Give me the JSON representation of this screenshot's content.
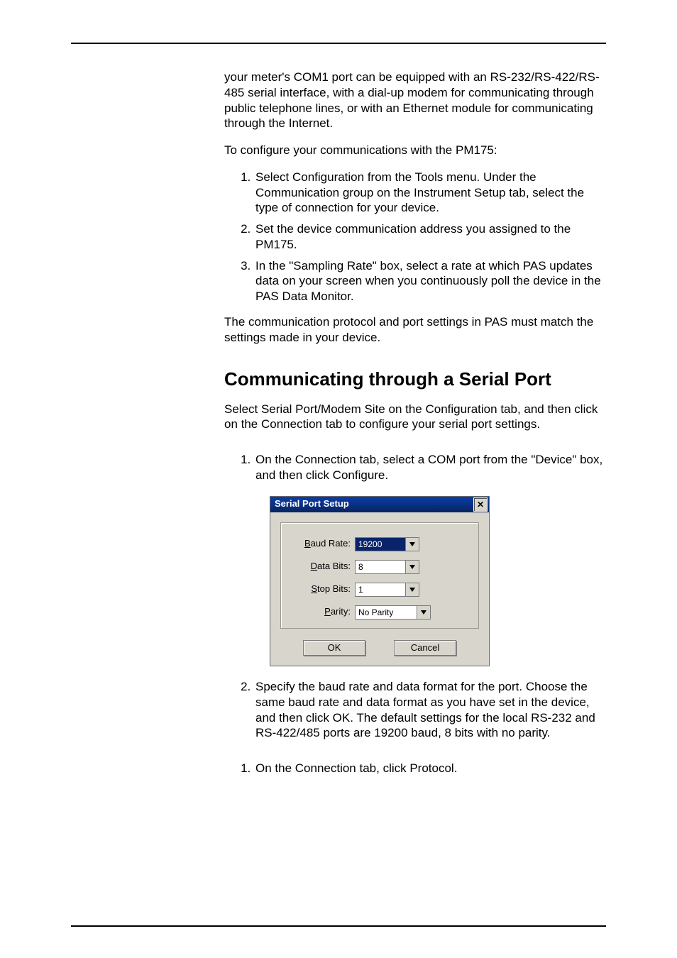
{
  "intro": {
    "p1": "your meter's COM1 port can be equipped with an RS-232/RS-422/RS-485 serial interface, with a dial-up modem for communicating through public telephone lines, or with an Ethernet module for communicating through the Internet.",
    "p2": "To configure your communications with the PM175:",
    "steps": [
      "Select Configuration from the Tools menu. Under the Communication group on the Instrument Setup tab, select the type of connection for your device.",
      "Set the device communication address you assigned to the PM175.",
      "In the \"Sampling Rate\" box, select a rate at which PAS updates data on your screen when you continuously poll the device in the PAS Data Monitor."
    ],
    "p3": "The communication protocol and port settings in PAS must match the settings made in your device."
  },
  "section": {
    "heading": "Communicating through a Serial Port",
    "p1": "Select Serial Port/Modem Site on the Configuration tab, and then click on the Connection tab to configure your serial port settings.",
    "step1": "On the Connection tab, select a COM port from the \"Device\" box, and then click Configure.",
    "step2": "Specify the baud rate and data format for the port. Choose the same baud rate and data format as you have set in the device, and then click OK. The default settings for the local RS-232 and RS-422/485 ports are 19200 baud, 8 bits with no parity.",
    "after_step": "On the Connection tab, click Protocol."
  },
  "dialog": {
    "title": "Serial Port Setup",
    "fields": {
      "baud": {
        "label_pre": "B",
        "label_rest": "aud Rate:",
        "value": "19200"
      },
      "data": {
        "label_pre": "D",
        "label_rest": "ata Bits:",
        "value": "8"
      },
      "stop": {
        "label_pre": "S",
        "label_rest": "top Bits:",
        "value": "1"
      },
      "parity": {
        "label_pre": "P",
        "label_rest": "arity:",
        "value": "No Parity"
      }
    },
    "ok": "OK",
    "cancel": "Cancel",
    "close_glyph": "✕"
  }
}
